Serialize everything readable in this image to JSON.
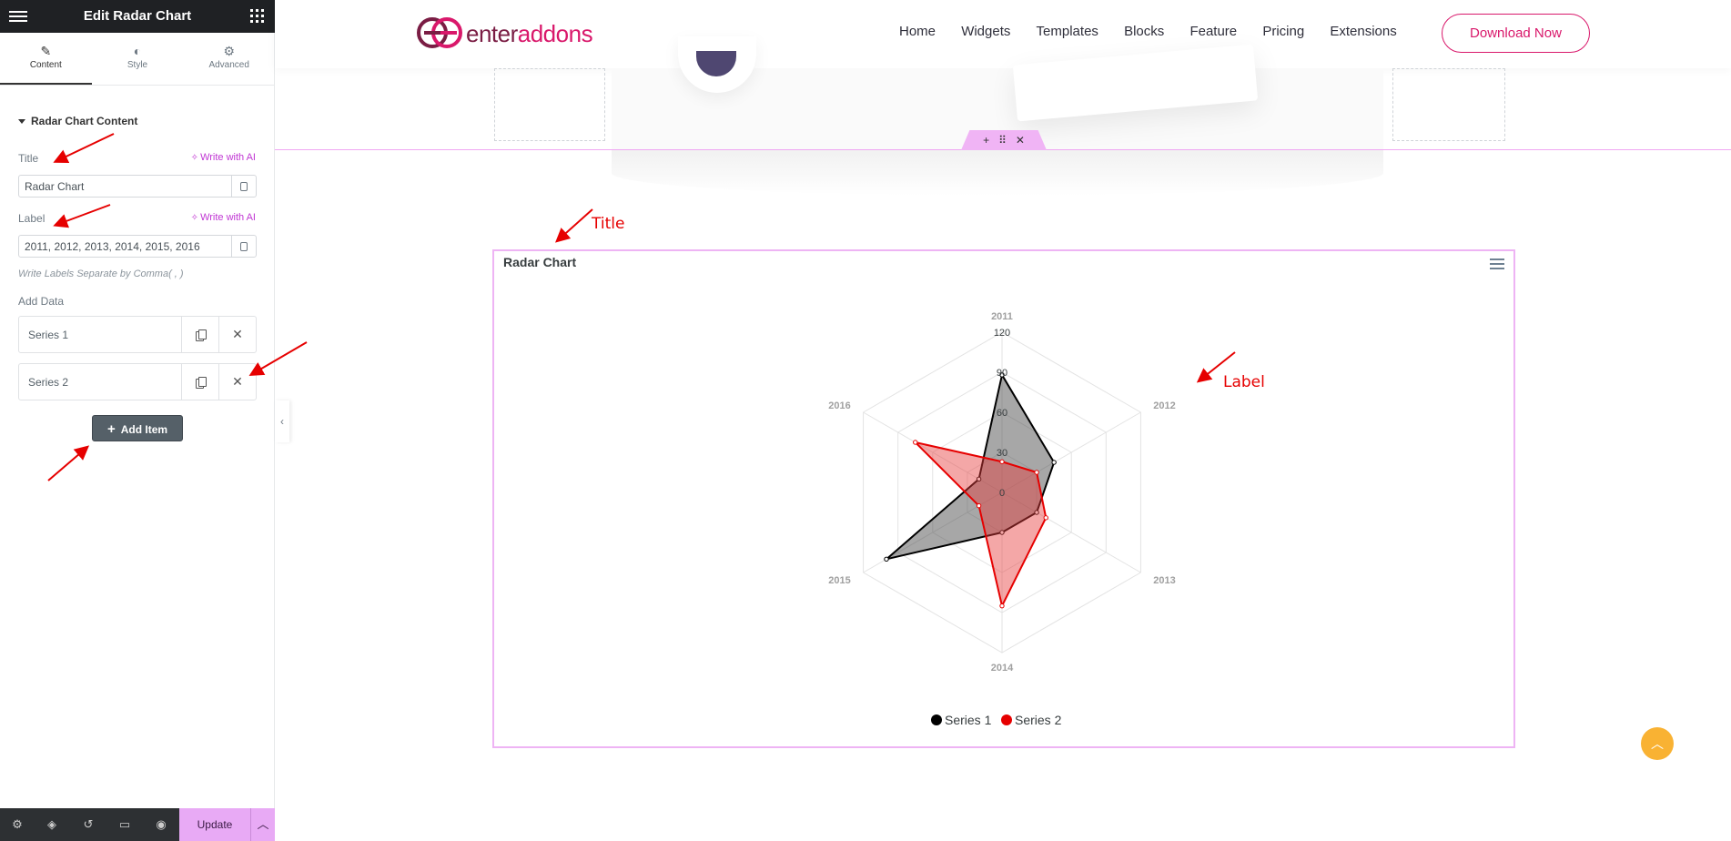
{
  "editor": {
    "title": "Edit Radar Chart",
    "tabs": [
      {
        "label": "Content",
        "icon": "pencil-icon"
      },
      {
        "label": "Style",
        "icon": "contrast-icon"
      },
      {
        "label": "Advanced",
        "icon": "gear-icon"
      }
    ],
    "section_title": "Radar Chart Content",
    "title_field": {
      "label": "Title",
      "value": "Radar Chart"
    },
    "label_field": {
      "label": "Label",
      "value": "2011, 2012, 2013, 2014, 2015, 2016"
    },
    "ai_label": "Write with AI",
    "hint": "Write Labels Separate by Comma( , )",
    "add_data_label": "Add Data",
    "items": [
      "Series 1",
      "Series 2"
    ],
    "add_item_label": "Add Item",
    "update_label": "Update"
  },
  "header": {
    "logo_text": "enteraddons",
    "nav": [
      "Home",
      "Widgets",
      "Templates",
      "Blocks",
      "Feature",
      "Pricing",
      "Extensions"
    ],
    "cta": "Download Now",
    "colors": {
      "brand": "#d9186b",
      "brand_dark": "#7a1d44"
    }
  },
  "annotations": {
    "title": "Title",
    "label": "Label"
  },
  "chart_data": {
    "type": "radar",
    "title": "Radar Chart",
    "categories": [
      "2011",
      "2012",
      "2013",
      "2014",
      "2015",
      "2016"
    ],
    "scale_ticks": [
      0,
      30,
      60,
      90,
      120
    ],
    "rmax": 120,
    "series": [
      {
        "name": "Series 1",
        "values": [
          88,
          45,
          30,
          30,
          100,
          20
        ],
        "color": "#000000",
        "fill": "rgba(60,60,60,0.45)"
      },
      {
        "name": "Series 2",
        "values": [
          23,
          30,
          38,
          85,
          20,
          75
        ],
        "color": "#e60000",
        "fill": "rgba(230,60,60,0.45)"
      }
    ],
    "legend": "bottom-center"
  }
}
